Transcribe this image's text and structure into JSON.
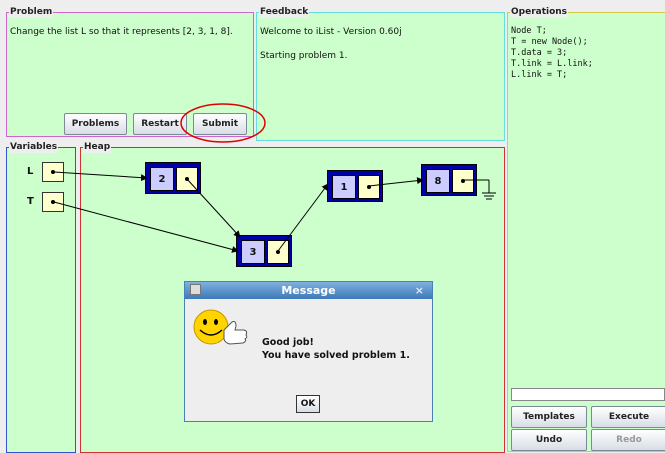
{
  "problem": {
    "legend": "Problem",
    "text": "Change the list L so that it represents [2, 3, 1, 8].",
    "buttons": {
      "problems": "Problems",
      "restart": "Restart",
      "submit": "Submit"
    }
  },
  "feedback": {
    "legend": "Feedback",
    "text": "Welcome to iList - Version 0.60j\n\nStarting problem 1."
  },
  "operations": {
    "legend": "Operations",
    "code": "Node T;\nT = new Node();\nT.data = 3;\nT.link = L.link;\nL.link = T;",
    "buttons": {
      "templates": "Templates",
      "execute": "Execute",
      "undo": "Undo",
      "redo": "Redo"
    }
  },
  "variables": {
    "legend": "Variables",
    "items": [
      "L",
      "T"
    ]
  },
  "heap": {
    "legend": "Heap",
    "nodes": [
      "2",
      "1",
      "8",
      "3"
    ]
  },
  "dialog": {
    "title": "Message",
    "close": "×",
    "line1": "Good job!",
    "line2": "You have solved problem 1.",
    "ok": "OK"
  },
  "colors": {
    "panel_bg": "#ccffcc",
    "node_border": "#0000aa",
    "node_data": "#ccccff",
    "pointer_box": "#ffffcc",
    "highlight_circle": "#dd0000"
  }
}
